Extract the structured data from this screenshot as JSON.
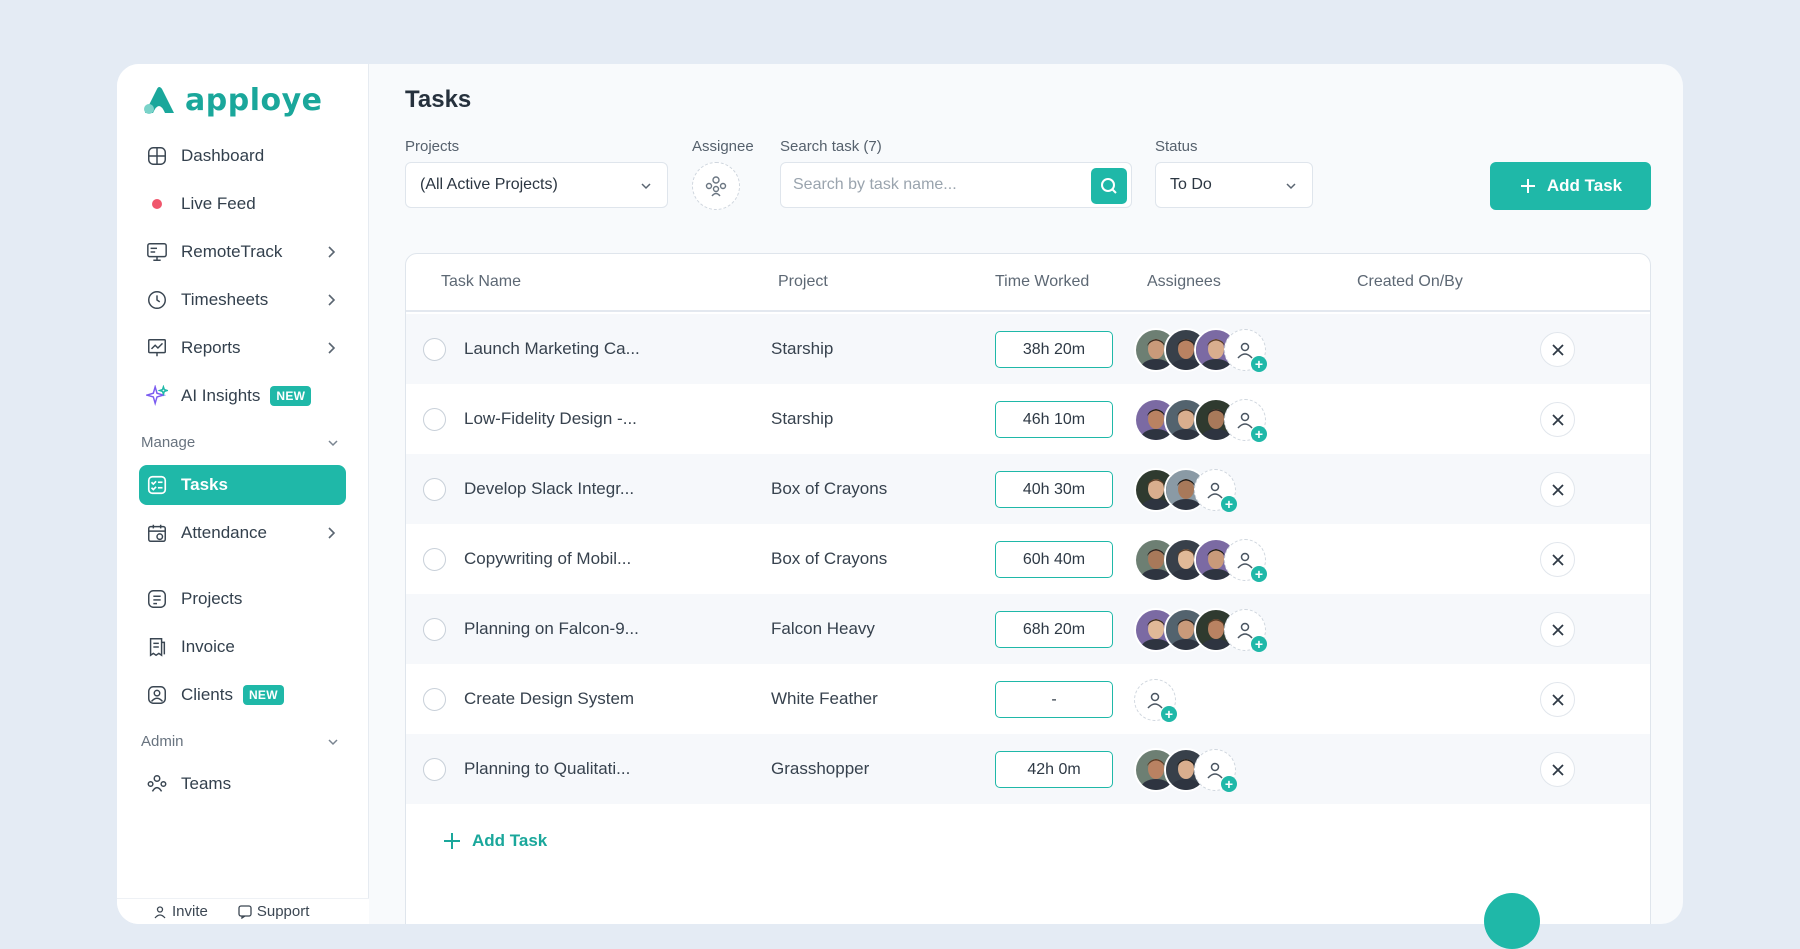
{
  "app": {
    "brand": "apploye"
  },
  "sidebar": {
    "items": [
      {
        "label": "Dashboard",
        "icon": "dashboard-icon"
      },
      {
        "label": "Live Feed",
        "icon": "live-dot-icon"
      },
      {
        "label": "RemoteTrack",
        "icon": "monitor-icon"
      },
      {
        "label": "Timesheets",
        "icon": "clock-icon"
      },
      {
        "label": "Reports",
        "icon": "chart-icon"
      },
      {
        "label": "AI Insights",
        "icon": "sparkle-icon",
        "badge": "NEW"
      }
    ],
    "manage_label": "Manage",
    "manage_items": [
      {
        "label": "Tasks",
        "icon": "tasks-icon",
        "active": true
      },
      {
        "label": "Attendance",
        "icon": "calendar-icon"
      }
    ],
    "other_items": [
      {
        "label": "Projects",
        "icon": "projects-icon"
      },
      {
        "label": "Invoice",
        "icon": "invoice-icon"
      },
      {
        "label": "Clients",
        "icon": "clients-icon",
        "badge": "NEW"
      }
    ],
    "admin_label": "Admin",
    "admin_items": [
      {
        "label": "Teams",
        "icon": "teams-icon"
      }
    ],
    "footer": {
      "invite": "Invite",
      "support": "Support"
    }
  },
  "main": {
    "title": "Tasks",
    "filters": {
      "projects_label": "Projects",
      "projects_value": "(All Active Projects)",
      "assignee_label": "Assignee",
      "search_label": "Search task (7)",
      "search_placeholder": "Search by task name...",
      "status_label": "Status",
      "status_value": "To Do",
      "add_task_label": "Add Task"
    },
    "table": {
      "columns": [
        "Task Name",
        "Project",
        "Time Worked",
        "Assignees",
        "Created On/By"
      ],
      "rows": [
        {
          "name": "Launch Marketing Ca...",
          "project": "Starship",
          "time": "38h 20m",
          "avatars": 3
        },
        {
          "name": "Low-Fidelity Design -...",
          "project": "Starship",
          "time": "46h 10m",
          "avatars": 3
        },
        {
          "name": "Develop Slack Integr...",
          "project": "Box of Crayons",
          "time": "40h 30m",
          "avatars": 2
        },
        {
          "name": "Copywriting of Mobil...",
          "project": "Box of Crayons",
          "time": "60h 40m",
          "avatars": 3
        },
        {
          "name": "Planning on Falcon-9...",
          "project": "Falcon Heavy",
          "time": "68h 20m",
          "avatars": 3
        },
        {
          "name": "Create Design System",
          "project": "White Feather",
          "time": "-",
          "avatars": 0
        },
        {
          "name": "Planning to Qualitati...",
          "project": "Grasshopper",
          "time": "42h 0m",
          "avatars": 2
        }
      ],
      "add_row_label": "Add Task"
    }
  },
  "colors": {
    "accent": "#1fb8a8",
    "background": "#e4ebf4",
    "live_dot": "#f0566c"
  }
}
